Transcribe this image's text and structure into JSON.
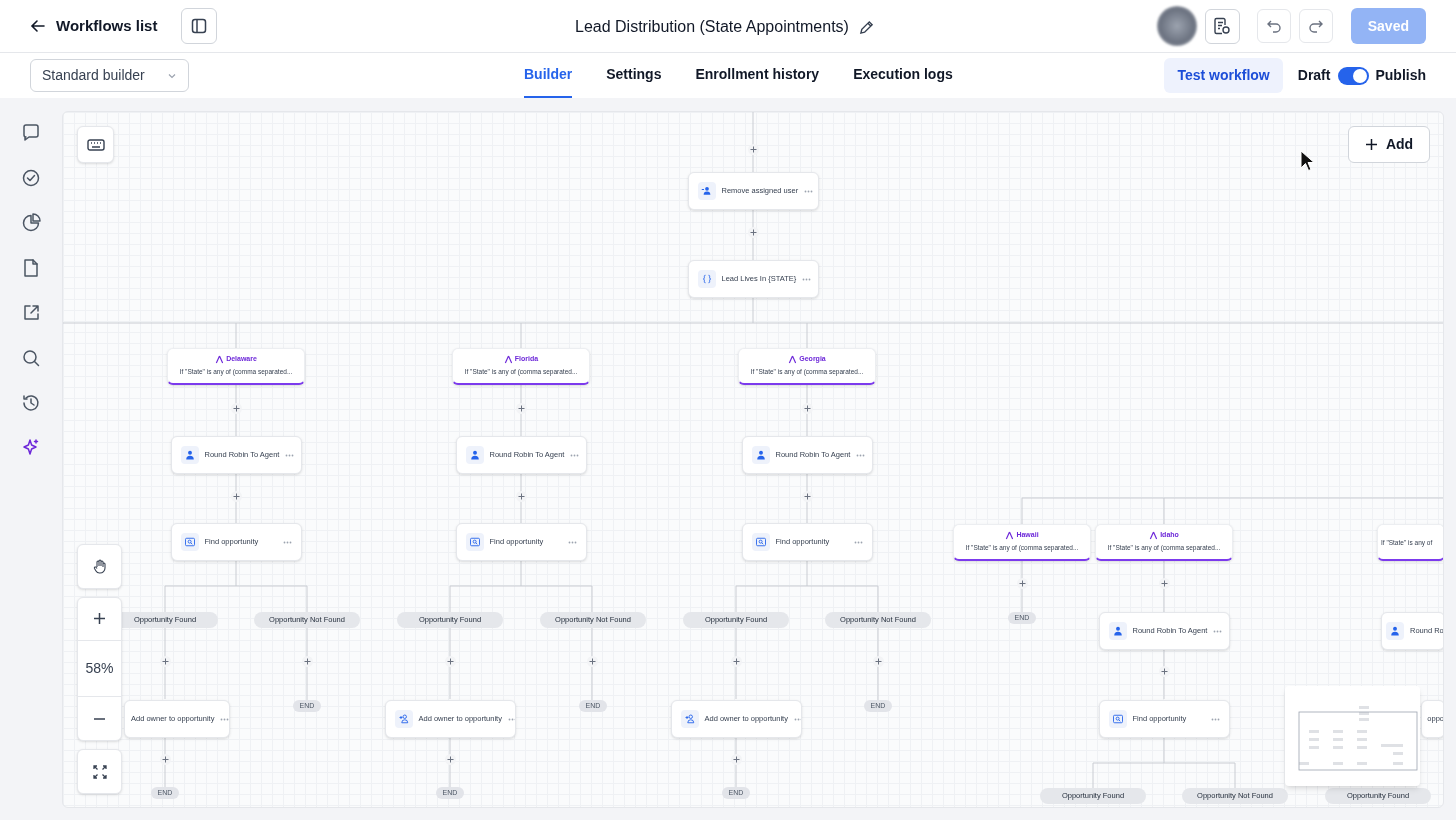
{
  "header": {
    "back_link": "Workflows list",
    "title": "Lead Distribution (State Appointments)",
    "saved_button": {
      "label": "Saved",
      "disabled": true
    }
  },
  "toolbar": {
    "builder_select": "Standard builder",
    "tabs": [
      {
        "label": "Builder",
        "selected": true
      },
      {
        "label": "Settings",
        "selected": false
      },
      {
        "label": "Enrollment history",
        "selected": false
      },
      {
        "label": "Execution logs",
        "selected": false
      }
    ],
    "test_button": "Test workflow",
    "draft_label": "Draft",
    "publish_toggle": {
      "on": true
    },
    "publish_label": "Publish"
  },
  "sidebar": {
    "items": [
      {
        "selected": false
      },
      {
        "selected": false
      },
      {
        "selected": false
      },
      {
        "selected": false
      },
      {
        "selected": false
      },
      {
        "selected": false
      },
      {
        "selected": false
      },
      {
        "selected": true
      }
    ]
  },
  "canvas": {
    "add_button": "Add",
    "zoom_level": "58%",
    "nodes": [
      {
        "kind": "remove-user",
        "label": "Remove assigned user"
      },
      {
        "kind": "condition",
        "label": "Lead Lives In {STATE}"
      },
      {
        "kind": "branch",
        "title": "Delaware",
        "condition": "If \"State\" is any of (comma separated..."
      },
      {
        "kind": "branch",
        "title": "Florida",
        "condition": "If \"State\" is any of (comma separated..."
      },
      {
        "kind": "branch",
        "title": "Georgia",
        "condition": "If \"State\" is any of (comma separated..."
      },
      {
        "kind": "round-robin",
        "label": "Round Robin To Agent"
      },
      {
        "kind": "round-robin",
        "label": "Round Robin To Agent"
      },
      {
        "kind": "round-robin",
        "label": "Round Robin To Agent"
      },
      {
        "kind": "find",
        "label": "Find opportunity"
      },
      {
        "kind": "find",
        "label": "Find opportunity"
      },
      {
        "kind": "find",
        "label": "Find opportunity"
      },
      {
        "kind": "pill",
        "label": "Opportunity Found"
      },
      {
        "kind": "pill",
        "label": "Opportunity Not Found"
      },
      {
        "kind": "pill",
        "label": "Opportunity Found"
      },
      {
        "kind": "pill",
        "label": "Opportunity Not Found"
      },
      {
        "kind": "pill",
        "label": "Opportunity Found"
      },
      {
        "kind": "pill",
        "label": "Opportunity Not Found"
      },
      {
        "kind": "add-owner",
        "label": "Add owner to opportunity"
      },
      {
        "kind": "end",
        "label": "END"
      },
      {
        "kind": "add-owner",
        "label": "Add owner to opportunity"
      },
      {
        "kind": "end",
        "label": "END"
      },
      {
        "kind": "add-owner",
        "label": "Add owner to opportunity"
      },
      {
        "kind": "end",
        "label": "END"
      },
      {
        "kind": "end",
        "label": "END"
      },
      {
        "kind": "end",
        "label": "END"
      },
      {
        "kind": "end",
        "label": "END"
      },
      {
        "kind": "branch",
        "title": "Hawaii",
        "condition": "If \"State\" is any of (comma separated..."
      },
      {
        "kind": "branch",
        "title": "Idaho",
        "condition": "If \"State\" is any of (comma separated..."
      },
      {
        "kind": "branch",
        "condition": "If \"State\" is any of"
      },
      {
        "kind": "end",
        "label": "END"
      },
      {
        "kind": "round-robin",
        "label": "Round Robin To Agent"
      },
      {
        "kind": "round-robin",
        "label": "Round Ro"
      },
      {
        "kind": "find",
        "label": "Find opportunity"
      },
      {
        "kind": "add-owner",
        "label": "oppo"
      },
      {
        "kind": "pill",
        "label": "Opportunity Found"
      },
      {
        "kind": "pill",
        "label": "Opportunity Not Found"
      },
      {
        "kind": "pill",
        "label": "Opportunity Found"
      }
    ]
  }
}
